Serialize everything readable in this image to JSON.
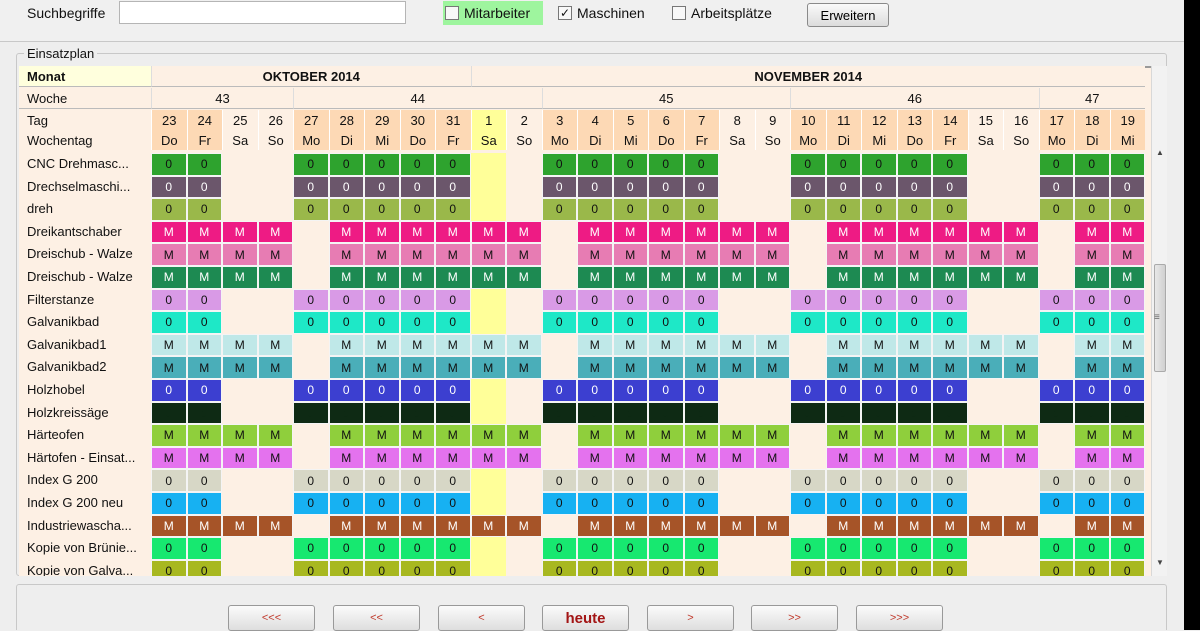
{
  "filter": {
    "search_label": "Suchbegriffe",
    "search_value": "",
    "checkboxes": [
      {
        "label": "Mitarbeiter",
        "checked": false
      },
      {
        "label": "Maschinen",
        "checked": true
      },
      {
        "label": "Arbeitsplätze",
        "checked": false
      }
    ],
    "expand_button": "Erweitern"
  },
  "plan": {
    "title": "Einsatzplan",
    "row_labels": {
      "month": "Monat",
      "week": "Woche",
      "day": "Tag",
      "weekday": "Wochentag"
    },
    "months": [
      {
        "label": "OKTOBER 2014",
        "days": 9
      },
      {
        "label": "NOVEMBER 2014",
        "days": 19
      }
    ],
    "weeks": [
      {
        "label": "43",
        "days": 4
      },
      {
        "label": "44",
        "days": 7
      },
      {
        "label": "45",
        "days": 7
      },
      {
        "label": "46",
        "days": 7
      },
      {
        "label": "47",
        "days": 3
      }
    ],
    "days": [
      "23",
      "24",
      "25",
      "26",
      "27",
      "28",
      "29",
      "30",
      "31",
      "1",
      "2",
      "3",
      "4",
      "5",
      "6",
      "7",
      "8",
      "9",
      "10",
      "11",
      "12",
      "13",
      "14",
      "15",
      "16",
      "17",
      "18",
      "19"
    ],
    "weekdays": [
      "Do",
      "Fr",
      "Sa",
      "So",
      "Mo",
      "Di",
      "Mi",
      "Do",
      "Fr",
      "Sa",
      "So",
      "Mo",
      "Di",
      "Mi",
      "Do",
      "Fr",
      "Sa",
      "So",
      "Mo",
      "Di",
      "Mi",
      "Do",
      "Fr",
      "Sa",
      "So",
      "Mo",
      "Di",
      "Mi"
    ],
    "today_index": 9,
    "colors": {
      "weekday_header": "#fdd9b5",
      "weekend_header": "#fdf0e4",
      "today": "#ffff99"
    },
    "machines": [
      {
        "name": "CNC Drehmasc...",
        "color": "#2ea32e",
        "value": "0",
        "pattern": "w"
      },
      {
        "name": "Drechselmaschi...",
        "color": "#6b566b",
        "value": "0",
        "pattern": "w"
      },
      {
        "name": "dreh",
        "color": "#9ab84a",
        "value": "0",
        "pattern": "w"
      },
      {
        "name": "Dreikantschaber",
        "color": "#ee1b84",
        "value": "M",
        "pattern": "m"
      },
      {
        "name": "Dreischub - Walze",
        "color": "#e77cb3",
        "value": "M",
        "pattern": "m"
      },
      {
        "name": "Dreischub - Walze",
        "color": "#1d8a52",
        "value": "M",
        "pattern": "m"
      },
      {
        "name": "Filterstanze",
        "color": "#d99ae6",
        "value": "0",
        "pattern": "w"
      },
      {
        "name": "Galvanikbad",
        "color": "#1ee8c7",
        "value": "0",
        "pattern": "w"
      },
      {
        "name": "Galvanikbad1",
        "color": "#bfe8e8",
        "value": "M",
        "pattern": "m"
      },
      {
        "name": "Galvanikbad2",
        "color": "#4aaeb9",
        "value": "M",
        "pattern": "m"
      },
      {
        "name": "Holzhobel",
        "color": "#3c3fd0",
        "value": "0",
        "pattern": "w"
      },
      {
        "name": "Holzkreissäge",
        "color": "#0e2a14",
        "value": "0",
        "pattern": "w"
      },
      {
        "name": "Härteofen",
        "color": "#8fcf3c",
        "value": "M",
        "pattern": "m"
      },
      {
        "name": "Härtofen - Einsat...",
        "color": "#e472ee",
        "value": "M",
        "pattern": "m"
      },
      {
        "name": "Index G 200",
        "color": "#d7d7c6",
        "value": "0",
        "pattern": "w"
      },
      {
        "name": "Index G 200 neu",
        "color": "#17b1f2",
        "value": "0",
        "pattern": "w"
      },
      {
        "name": "Industriewascha...",
        "color": "#a65428",
        "value": "M",
        "pattern": "m"
      },
      {
        "name": "Kopie von Brünie...",
        "color": "#17e870",
        "value": "0",
        "pattern": "w"
      },
      {
        "name": "Kopie von Galva...",
        "color": "#a8b820",
        "value": "0",
        "pattern": "w"
      }
    ]
  },
  "nav": {
    "buttons": [
      "<<<",
      "<<",
      "<",
      "heute",
      ">",
      ">>",
      ">>>"
    ]
  }
}
